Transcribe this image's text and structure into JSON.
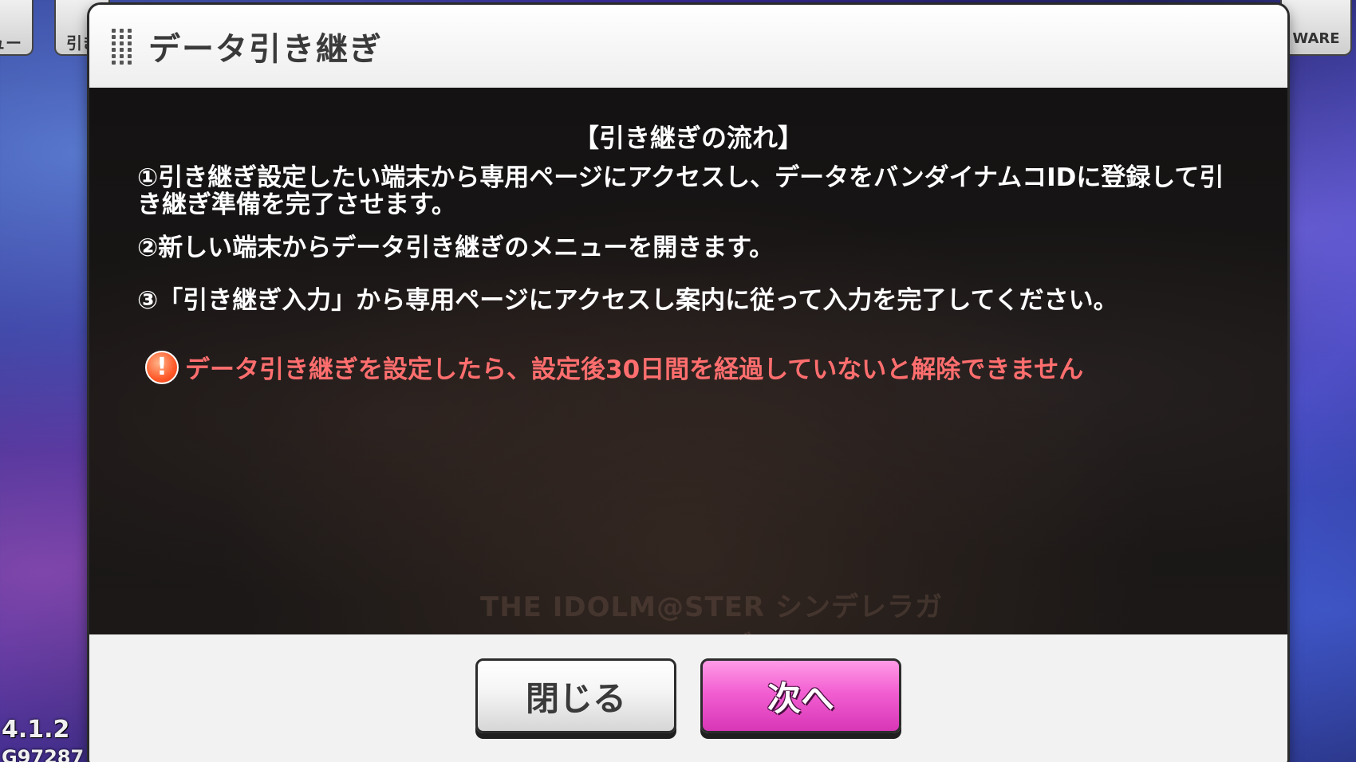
{
  "background": {
    "left_button_1_label": "ュー",
    "left_button_2_label": "引き",
    "right_button_label": "WARE",
    "version": "4.1.2",
    "user_id": "G97287"
  },
  "dialog": {
    "title": "データ引き継ぎ",
    "flow_heading": "【引き継ぎの流れ】",
    "steps": [
      "①引き継ぎ設定したい端末から専用ページにアクセスし、データをバンダイナムコIDに登録して引き継ぎ準備を完了させます。",
      "②新しい端末からデータ引き継ぎのメニューを開きます。",
      "③「引き継ぎ入力」から専用ページにアクセスし案内に従って入力を完了してください。"
    ],
    "warning_icon_glyph": "!",
    "warning": "データ引き継ぎを設定したら、設定後30日間を経過していないと解除できません",
    "watermark": "THE IDOLM@STER シンデレラガールズ",
    "close_label": "閉じる",
    "next_label": "次へ"
  },
  "colors": {
    "warning_text": "#ff6e6e",
    "next_button": "#f25fd2"
  }
}
